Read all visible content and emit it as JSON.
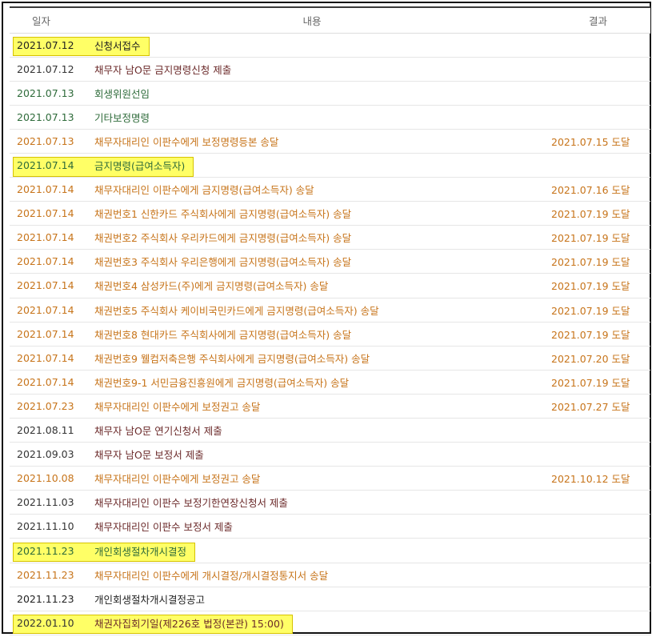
{
  "header": {
    "date": "일자",
    "content": "내용",
    "result": "결과"
  },
  "colors": {
    "dark": "#6b2a2a",
    "green": "#2e6b3a",
    "orange": "#c7741a",
    "black": "#222222",
    "highlight": "#ffff66"
  },
  "rows": [
    {
      "date": "2021.07.12",
      "content": "신청서접수",
      "result": "",
      "highlight": true,
      "tone": "black"
    },
    {
      "date": "2021.07.12",
      "content": "채무자 남O문 금지명령신청 제출",
      "result": "",
      "highlight": false,
      "tone": "dark"
    },
    {
      "date": "2021.07.13",
      "content": "회생위원선임",
      "result": "",
      "highlight": false,
      "tone": "green"
    },
    {
      "date": "2021.07.13",
      "content": "기타보정명령",
      "result": "",
      "highlight": false,
      "tone": "green"
    },
    {
      "date": "2021.07.13",
      "content": "채무자대리인 이판수에게 보정명령등본 송달",
      "result": "2021.07.15 도달",
      "highlight": false,
      "tone": "orange"
    },
    {
      "date": "2021.07.14",
      "content": "금지명령(급여소득자)",
      "result": "",
      "highlight": true,
      "tone": "green"
    },
    {
      "date": "2021.07.14",
      "content": "채무자대리인 이판수에게 금지명령(급여소득자) 송달",
      "result": "2021.07.16 도달",
      "highlight": false,
      "tone": "orange"
    },
    {
      "date": "2021.07.14",
      "content": "채권번호1 신한카드 주식회사에게 금지명령(급여소득자) 송달",
      "result": "2021.07.19 도달",
      "highlight": false,
      "tone": "orange"
    },
    {
      "date": "2021.07.14",
      "content": "채권번호2 주식회사 우리카드에게 금지명령(급여소득자) 송달",
      "result": "2021.07.19 도달",
      "highlight": false,
      "tone": "orange"
    },
    {
      "date": "2021.07.14",
      "content": "채권번호3 주식회사 우리은행에게 금지명령(급여소득자) 송달",
      "result": "2021.07.19 도달",
      "highlight": false,
      "tone": "orange"
    },
    {
      "date": "2021.07.14",
      "content": "채권번호4 삼성카드(주)에게 금지명령(급여소득자) 송달",
      "result": "2021.07.19 도달",
      "highlight": false,
      "tone": "orange"
    },
    {
      "date": "2021.07.14",
      "content": "채권번호5 주식회사 케이비국민카드에게 금지명령(급여소득자) 송달",
      "result": "2021.07.19 도달",
      "highlight": false,
      "tone": "orange"
    },
    {
      "date": "2021.07.14",
      "content": "채권번호8 현대카드 주식회사에게 금지명령(급여소득자) 송달",
      "result": "2021.07.19 도달",
      "highlight": false,
      "tone": "orange"
    },
    {
      "date": "2021.07.14",
      "content": "채권번호9 웰컴저축은행 주식회사에게 금지명령(급여소득자) 송달",
      "result": "2021.07.20 도달",
      "highlight": false,
      "tone": "orange"
    },
    {
      "date": "2021.07.14",
      "content": "채권번호9-1 서민금융진흥원에게 금지명령(급여소득자) 송달",
      "result": "2021.07.19 도달",
      "highlight": false,
      "tone": "orange"
    },
    {
      "date": "2021.07.23",
      "content": "채무자대리인 이판수에게 보정권고 송달",
      "result": "2021.07.27 도달",
      "highlight": false,
      "tone": "orange"
    },
    {
      "date": "2021.08.11",
      "content": "채무자 남O문 연기신청서 제출",
      "result": "",
      "highlight": false,
      "tone": "dark"
    },
    {
      "date": "2021.09.03",
      "content": "채무자 남O문 보정서 제출",
      "result": "",
      "highlight": false,
      "tone": "dark"
    },
    {
      "date": "2021.10.08",
      "content": "채무자대리인 이판수에게 보정권고 송달",
      "result": "2021.10.12 도달",
      "highlight": false,
      "tone": "orange"
    },
    {
      "date": "2021.11.03",
      "content": "채무자대리인 이판수 보정기한연장신청서 제출",
      "result": "",
      "highlight": false,
      "tone": "dark"
    },
    {
      "date": "2021.11.10",
      "content": "채무자대리인 이판수 보정서 제출",
      "result": "",
      "highlight": false,
      "tone": "dark"
    },
    {
      "date": "2021.11.23",
      "content": "개인회생절차개시결정",
      "result": "",
      "highlight": true,
      "tone": "green"
    },
    {
      "date": "2021.11.23",
      "content": "채무자대리인 이판수에게 개시결정/개시결정통지서 송달",
      "result": "",
      "highlight": false,
      "tone": "orange"
    },
    {
      "date": "2021.11.23",
      "content": "개인회생절차개시결정공고",
      "result": "",
      "highlight": false,
      "tone": "black"
    },
    {
      "date": "2022.01.10",
      "content": "채권자집회기일(제226호 법정(본관) 15:00)",
      "result": "",
      "highlight": true,
      "tone": "dark"
    }
  ]
}
